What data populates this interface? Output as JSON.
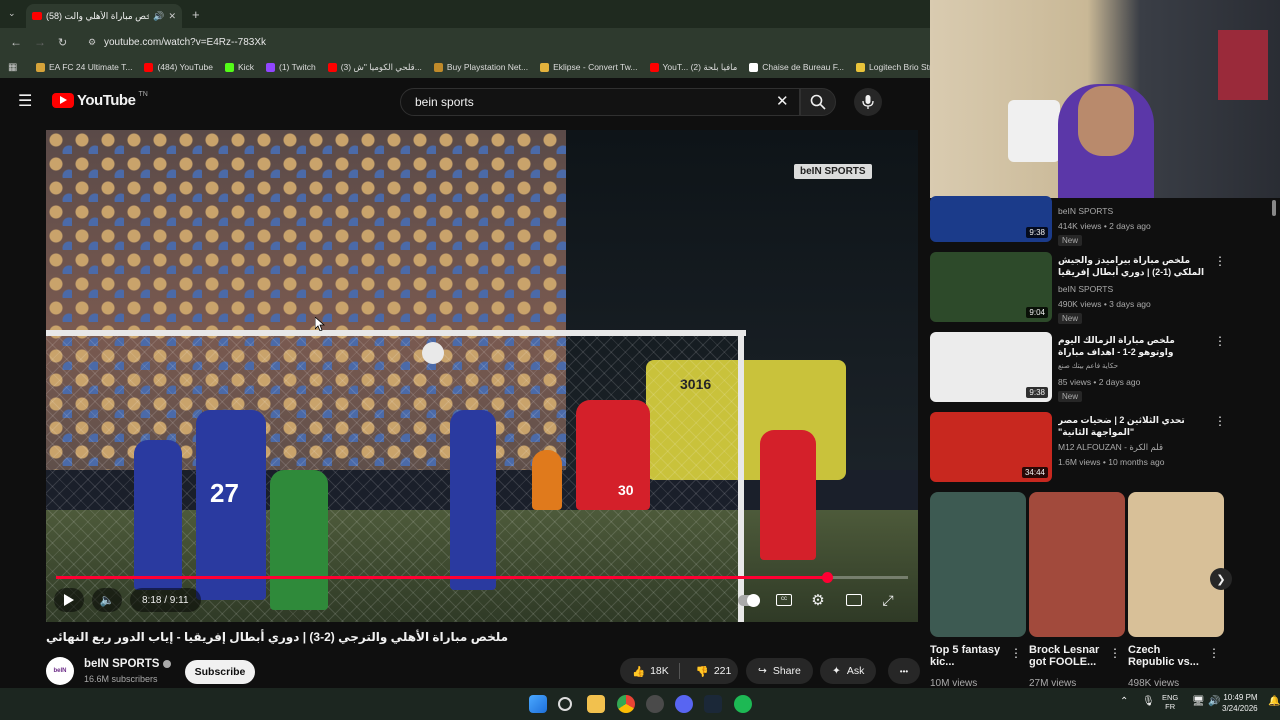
{
  "browser": {
    "tab_title": "(58) ملخص مباراة الأهلي والت...",
    "url": "youtube.com/watch?v=E4Rz--783Xk",
    "bookmarks": [
      {
        "label": "EA FC 24 Ultimate T...",
        "color": "#d6a33a"
      },
      {
        "label": "(484) YouTube",
        "color": "#ff0000"
      },
      {
        "label": "Kick",
        "color": "#53fc18"
      },
      {
        "label": "(1) Twitch",
        "color": "#9146ff"
      },
      {
        "label": "(3) قلحي الكوميا \"ش...",
        "color": "#ff0000"
      },
      {
        "label": "Buy Playstation Net...",
        "color": "#c08a2a"
      },
      {
        "label": "Eklipse - Convert Tw...",
        "color": "#e3b23c"
      },
      {
        "label": "YouT... مافيا بلحة (2)",
        "color": "#ff0000"
      },
      {
        "label": "Chaise de Bureau F...",
        "color": "#ffffff"
      },
      {
        "label": "Logitech Brio Strea...",
        "color": "#e8c33a"
      }
    ]
  },
  "yt_header": {
    "logo_text": "YouTube",
    "country": "TN",
    "search_value": "bein sports"
  },
  "player": {
    "watermark": "beIN SPORTS",
    "time": "8:18 / 9:11",
    "progress": 0.905,
    "jersey_a": "27",
    "jersey_b": "30",
    "board": "3016"
  },
  "video": {
    "title": "ملخص مباراة الأهلي والترجي (2-3) | دوري أبطال إفريقيا - إياب الدور ربع النهائي",
    "channel": "beIN SPORTS",
    "avatar_text": "beIN",
    "subscribers": "16.6M subscribers",
    "subscribe_label": "Subscribe",
    "likes": "18K",
    "dislikes": "221",
    "share_label": "Share",
    "ask_label": "Ask",
    "more_label": "•••"
  },
  "recommendations": [
    {
      "title": "",
      "channel": "beIN SPORTS",
      "meta": "414K views • 2 days ago",
      "badge": "New",
      "duration": "9:38",
      "thumb_color": "#1b3b8a"
    },
    {
      "title": "ملخص مباراة بيراميدز والجيش الملكي (1-2) | دوري أبطال إفريقيا - إياب الدور ربع ...",
      "channel": "beIN SPORTS",
      "meta": "490K views • 3 days ago",
      "badge": "New",
      "duration": "9:04",
      "thumb_color": "#2d4a2a"
    },
    {
      "title": "ملخص مباراة الزمالك اليوم واوتوهو 2-1 - اهداف مباراة الزمالك واوتوهو - اهداف ...",
      "channel": "حكاية فاعم بيتك صنع",
      "meta": "85 views • 2 days ago",
      "badge": "New",
      "duration": "9:38",
      "thumb_color": "#f2f2f2"
    },
    {
      "title": "تحدي الثلاثين 2 | ضحيات مصر \"المواجهة الثانية\"",
      "channel": "M12 ALFOUZAN - قلم الكرة",
      "meta": "1.6M views • 10 months ago",
      "badge": "",
      "duration": "34:44",
      "thumb_color": "#c8281f"
    }
  ],
  "shorts": [
    {
      "title": "Top 5 fantasy kic...",
      "views": "10M views",
      "color": "#3d5a52"
    },
    {
      "title": "Brock Lesnar got FOOLE...",
      "views": "27M views",
      "color": "#a24a3c"
    },
    {
      "title": "Czech Republic vs...",
      "views": "498K views",
      "color": "#d8c098"
    }
  ],
  "taskbar": {
    "lang_top": "ENG",
    "lang_bottom": "FR",
    "time": "10:49 PM",
    "date": "3/24/2026"
  },
  "colors": {
    "accent": "#ff0033",
    "bg": "#0f0f0f",
    "al_ahly_red": "#d4202a",
    "esperance_blue": "#2a3aa0"
  }
}
